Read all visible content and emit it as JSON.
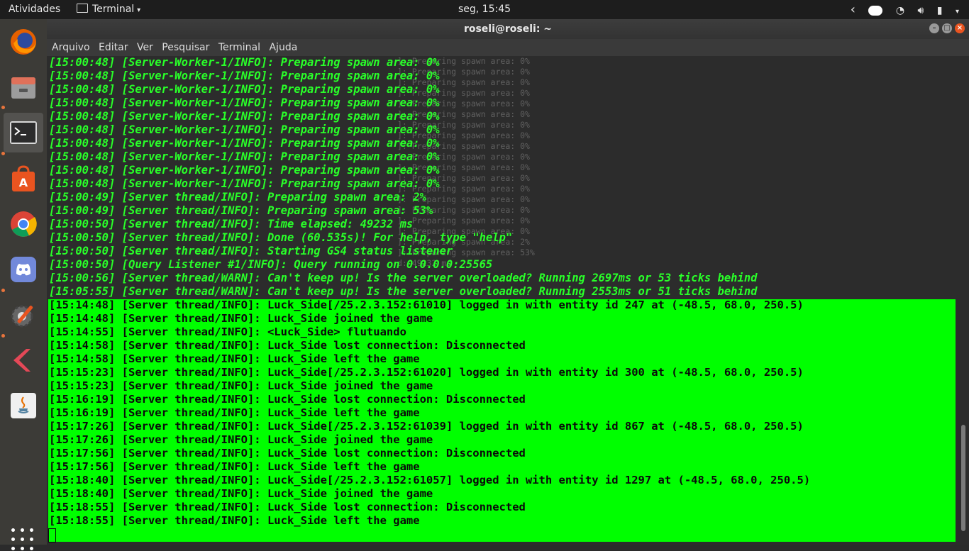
{
  "topbar": {
    "activities": "Atividades",
    "app_name": "Terminal",
    "clock": "seg, 15:45"
  },
  "dock": {
    "items": [
      {
        "name": "Firefox",
        "icon": "firefox-icon"
      },
      {
        "name": "Arquivos",
        "icon": "files-icon"
      },
      {
        "name": "Terminal",
        "icon": "terminal-icon"
      },
      {
        "name": "Ubuntu Software",
        "icon": "software-icon"
      },
      {
        "name": "Google Chrome",
        "icon": "chrome-icon"
      },
      {
        "name": "Discord",
        "icon": "discord-icon"
      },
      {
        "name": "Settings",
        "icon": "settings-icon"
      },
      {
        "name": "Kotlin",
        "icon": "kotlin-icon"
      },
      {
        "name": "Java",
        "icon": "java-icon"
      }
    ]
  },
  "window": {
    "title": "roseli@roseli: ~",
    "menu": [
      "Arquivo",
      "Editar",
      "Ver",
      "Pesquisar",
      "Terminal",
      "Ajuda"
    ]
  },
  "terminal": {
    "lines": [
      "[15:00:48] [Server-Worker-1/INFO]: Preparing spawn area: 0%",
      "[15:00:48] [Server-Worker-1/INFO]: Preparing spawn area: 0%",
      "[15:00:48] [Server-Worker-1/INFO]: Preparing spawn area: 0%",
      "[15:00:48] [Server-Worker-1/INFO]: Preparing spawn area: 0%",
      "[15:00:48] [Server-Worker-1/INFO]: Preparing spawn area: 0%",
      "[15:00:48] [Server-Worker-1/INFO]: Preparing spawn area: 0%",
      "[15:00:48] [Server-Worker-1/INFO]: Preparing spawn area: 0%",
      "[15:00:48] [Server-Worker-1/INFO]: Preparing spawn area: 0%",
      "[15:00:48] [Server-Worker-1/INFO]: Preparing spawn area: 0%",
      "[15:00:48] [Server-Worker-1/INFO]: Preparing spawn area: 0%",
      "[15:00:49] [Server thread/INFO]: Preparing spawn area: 2%",
      "[15:00:49] [Server thread/INFO]: Preparing spawn area: 53%",
      "[15:00:50] [Server thread/INFO]: Time elapsed: 49232 ms",
      "[15:00:50] [Server thread/INFO]: Done (60.535s)! For help, type \"help\"",
      "[15:00:50] [Server thread/INFO]: Starting GS4 status listener",
      "[15:00:50] [Query Listener #1/INFO]: Query running on 0.0.0.0:25565",
      "[15:00:56] [Server thread/WARN]: Can't keep up! Is the server overloaded? Running 2697ms or 53 ticks behind",
      "[15:05:55] [Server thread/WARN]: Can't keep up! Is the server overloaded? Running 2553ms or 51 ticks behind"
    ],
    "highlighted_lines": [
      "[15:14:48] [Server thread/INFO]: Luck_Side[/25.2.3.152:61010] logged in with entity id 247 at (-48.5, 68.0, 250.5)",
      "[15:14:48] [Server thread/INFO]: Luck_Side joined the game",
      "[15:14:55] [Server thread/INFO]: <Luck_Side> flutuando",
      "[15:14:58] [Server thread/INFO]: Luck_Side lost connection: Disconnected",
      "[15:14:58] [Server thread/INFO]: Luck_Side left the game",
      "[15:15:23] [Server thread/INFO]: Luck_Side[/25.2.3.152:61020] logged in with entity id 300 at (-48.5, 68.0, 250.5)",
      "[15:15:23] [Server thread/INFO]: Luck_Side joined the game",
      "[15:16:19] [Server thread/INFO]: Luck_Side lost connection: Disconnected",
      "[15:16:19] [Server thread/INFO]: Luck_Side left the game",
      "[15:17:26] [Server thread/INFO]: Luck_Side[/25.2.3.152:61039] logged in with entity id 867 at (-48.5, 68.0, 250.5)",
      "[15:17:26] [Server thread/INFO]: Luck_Side joined the game",
      "[15:17:56] [Server thread/INFO]: Luck_Side lost connection: Disconnected",
      "[15:17:56] [Server thread/INFO]: Luck_Side left the game",
      "[15:18:40] [Server thread/INFO]: Luck_Side[/25.2.3.152:61057] logged in with entity id 1297 at (-48.5, 68.0, 250.5)",
      "[15:18:40] [Server thread/INFO]: Luck_Side joined the game",
      "[15:18:55] [Server thread/INFO]: Luck_Side lost connection: Disconnected",
      "[15:18:55] [Server thread/INFO]: Luck_Side left the game"
    ],
    "ghost_lines": [
      "]: Preparing spawn area: 0%",
      "]: Preparing spawn area: 0%",
      "]: Preparing spawn area: 0%",
      "]: Preparing spawn area: 0%",
      "]: Preparing spawn area: 0%",
      "]: Preparing spawn area: 0%",
      "]: Preparing spawn area: 0%",
      "]: Preparing spawn area: 0%",
      "]: Preparing spawn area: 0%",
      "]: Preparing spawn area: 0%",
      "]: Preparing spawn area: 0%",
      "]: Preparing spawn area: 0%",
      "]: Preparing spawn area: 0%",
      "]: Preparing spawn area: 0%",
      "]: Preparing spawn area: 0%",
      "]: Preparing spawn area: 0%",
      "]: Preparing spawn area: 0%",
      "]: Preparing spawn area: 2%",
      "]: Preparing spawn area: 53%",
      "d: 49232 ms"
    ],
    "colors": {
      "text": "#29ff29",
      "highlight": "#00ff00",
      "background": "#2c2c2c"
    }
  }
}
